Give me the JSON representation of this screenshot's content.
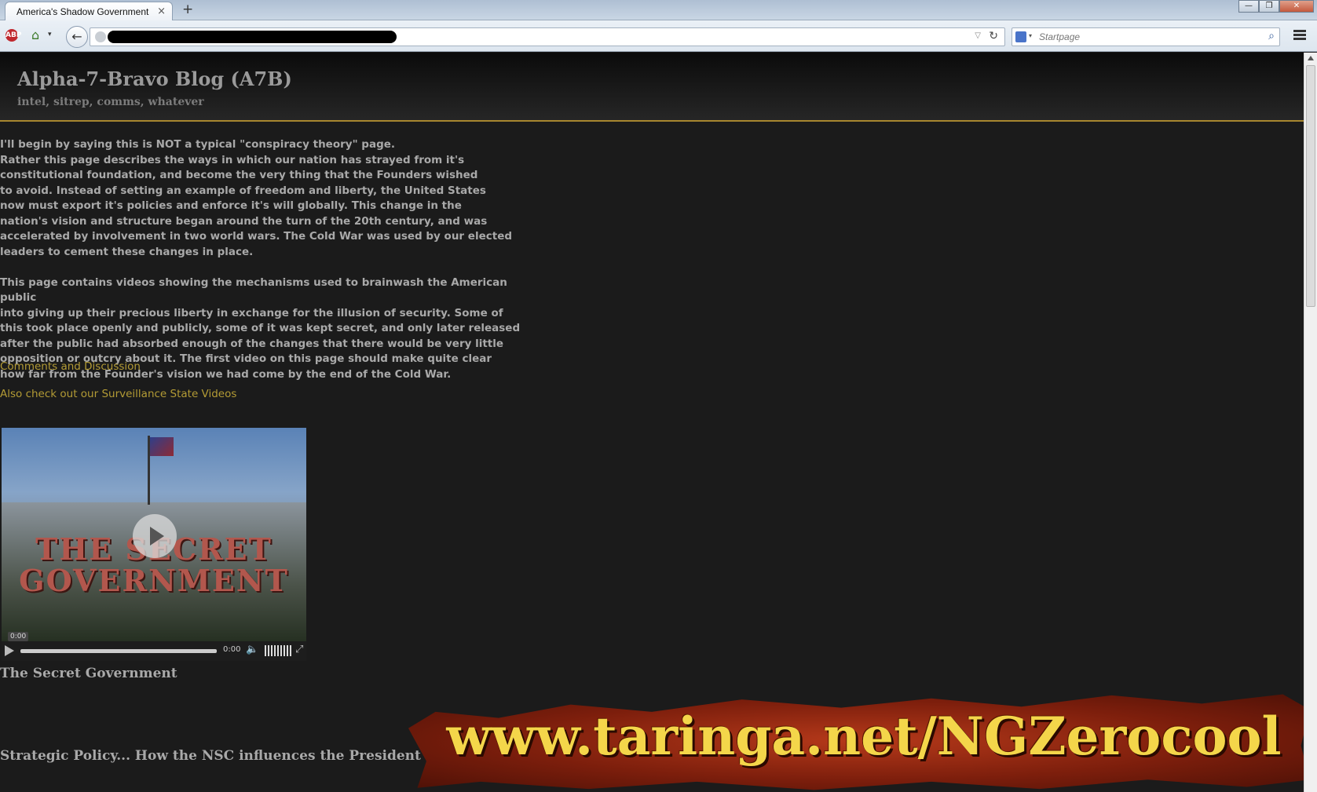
{
  "browser": {
    "tab_title": "America's Shadow Government",
    "tab_close": "×",
    "new_tab": "+",
    "search_placeholder": "Startpage",
    "window_controls": {
      "minimize": "—",
      "maximize": "❐",
      "close": "✕"
    }
  },
  "blog": {
    "title": "Alpha-7-Bravo Blog (A7B)",
    "tagline": "intel, sitrep, comms, whatever"
  },
  "intro": {
    "paragraph1": "I'll begin by saying this is NOT a typical \"conspiracy theory\" page.\nRather this page describes the ways in which our nation has strayed from it's\nconstitutional foundation, and become the very thing that the Founders wished\nto avoid. Instead of setting an example of freedom and liberty, the United States\nnow must export it's policies and enforce it's will globally. This change in the\nnation's vision and structure began around the turn of the 20th century, and was\naccelerated by involvement in two world wars. The Cold War was used by our elected\nleaders to cement these changes in place.",
    "paragraph2": "This page contains videos showing the mechanisms used to brainwash the American public\ninto giving up their precious liberty in exchange for the illusion of security. Some of\nthis took place openly and publicly, some of it was kept secret, and only later released\nafter the public had absorbed enough of the changes that there would be very little\nopposition or outcry about it. The first video on this page should make quite clear\nhow far from the Founder's vision we had come by the end of the Cold War."
  },
  "links": {
    "comments": "Comments and Discussion",
    "surveillance": "Also check out our Surveillance State Videos"
  },
  "video": {
    "frame_title": "THE SECRET\nGOVERNMENT",
    "time_tooltip": "0:00",
    "time_display": "0:00",
    "caption": "The Secret Government"
  },
  "section_heading": "Strategic Policy... How the NSC influences the President a",
  "watermark": "www.taringa.net/NGZerocool",
  "colors": {
    "header_rule": "#a7872f",
    "link": "#b39b35",
    "text": "#a9a9a9",
    "background": "#1b1b1b"
  },
  "icons": {
    "adblock": "adblock-icon",
    "home": "home-icon",
    "back": "back-arrow-icon",
    "reload": "reload-icon",
    "search": "magnifier-icon",
    "menu": "hamburger-menu-icon"
  }
}
